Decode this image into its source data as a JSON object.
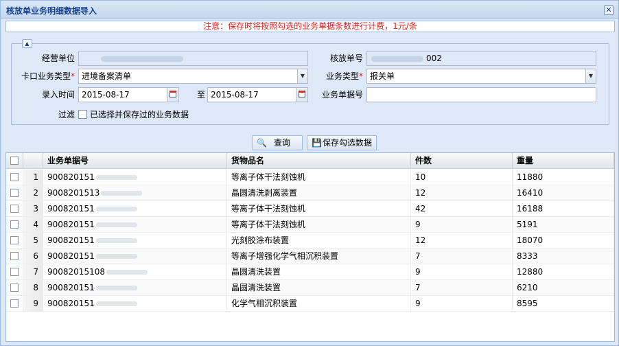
{
  "window": {
    "title": "核放单业务明细数据导入",
    "close": "✕"
  },
  "notice": "注意：保存时将按照勾选的业务单据条数进行计费，1元/条",
  "form": {
    "jy_unit_label": "经营单位",
    "jy_unit_value": "",
    "hfd_label": "核放单号",
    "hfd_value": "002",
    "kk_type_label": "卡口业务类型",
    "kk_type_value": "进境备案清单",
    "biz_type_label": "业务类型",
    "biz_type_value": "报关单",
    "entry_time_label": "录入时间",
    "date_from": "2015-08-17",
    "to_label": "至",
    "date_to": "2015-08-17",
    "doc_no_label": "业务单据号",
    "doc_no_value": "",
    "filter_label": "过滤",
    "filter_option": "已选择并保存过的业务数据"
  },
  "buttons": {
    "query": "查询",
    "save": "保存勾选数据"
  },
  "grid": {
    "headers": [
      "业务单据号",
      "货物品名",
      "件数",
      "重量"
    ],
    "rows": [
      {
        "idx": "1",
        "doc": "900820151",
        "name": "等离子体干法刻蚀机",
        "qty": "10",
        "weight": "11880"
      },
      {
        "idx": "2",
        "doc": "9008201513",
        "name": "晶圆清洗剥离装置",
        "qty": "12",
        "weight": "16410"
      },
      {
        "idx": "3",
        "doc": "900820151",
        "name": "等离子体干法刻蚀机",
        "qty": "42",
        "weight": "16188"
      },
      {
        "idx": "4",
        "doc": "900820151",
        "name": "等离子体干法刻蚀机",
        "qty": "9",
        "weight": "5191"
      },
      {
        "idx": "5",
        "doc": "900820151",
        "name": "光刻胶涂布装置",
        "qty": "12",
        "weight": "18070"
      },
      {
        "idx": "6",
        "doc": "900820151",
        "name": "等离子增强化学气相沉积装置",
        "qty": "7",
        "weight": "8333"
      },
      {
        "idx": "7",
        "doc": "90082015108",
        "name": "晶圆清洗装置",
        "qty": "9",
        "weight": "12880"
      },
      {
        "idx": "8",
        "doc": "900820151",
        "name": "晶圆清洗装置",
        "qty": "7",
        "weight": "6210"
      },
      {
        "idx": "9",
        "doc": "900820151",
        "name": "化学气相沉积装置",
        "qty": "9",
        "weight": "8595"
      }
    ]
  }
}
